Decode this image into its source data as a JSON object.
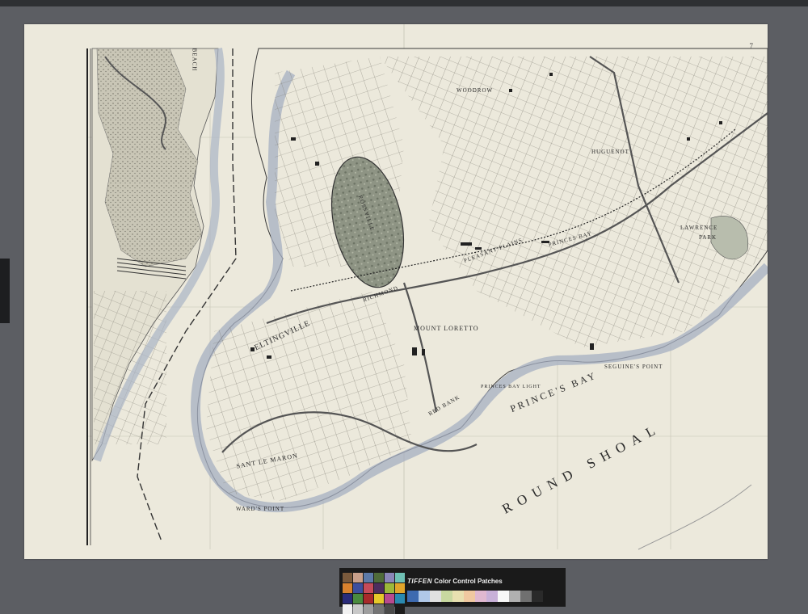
{
  "map": {
    "sheet_number": "7",
    "labels": {
      "beach": "BEACH",
      "woodrow": "WOODROW",
      "huguenot": "HUGUENOT",
      "rossville_park": "ROSSVILLE",
      "eltingville": "ELTINGVILLE",
      "richmond": "RICHMOND",
      "princes_bay_village": "PRINCES BAY",
      "lawrence_park": "LAWRENCE",
      "park": "PARK",
      "mount_loretto": "MOUNT LORETTO",
      "pleasant_plains": "PLEASANT PLAINS",
      "princes_bay_water": "PRINCE'S BAY",
      "round_shoal": "ROUND SHOAL",
      "seguines_point": "SEGUINE'S POINT",
      "wards_point": "WARD'S POINT",
      "red_bank": "RED BANK",
      "princes_bay_light": "PRINCES BAY LIGHT",
      "tottenville": "SANT LE MARON"
    }
  },
  "color_target": {
    "brand": "TIFFEN",
    "title": "Color Control Patches",
    "swatch_colors": [
      "#7a5a3c",
      "#c9a08a",
      "#5d7aa8",
      "#4f6b3a",
      "#8a86b8",
      "#6fc0b4",
      "#d8822e",
      "#3d4f9e",
      "#c44b5a",
      "#4d2d5e",
      "#9cb83a",
      "#e0a52a",
      "#2a2c7a",
      "#4a8a3e",
      "#a82a2a",
      "#e6c92a",
      "#b84a8e",
      "#2a8ab0",
      "#f2f2f2",
      "#c8c8c8",
      "#9e9e9e",
      "#747474",
      "#4a4a4a",
      "#1c1c1c"
    ],
    "scale_colors": [
      "#3d6ab0",
      "#b0c8e8",
      "#e0e0e0",
      "#c8d8a0",
      "#e8e0b0",
      "#f0c8a0",
      "#e0b8d0",
      "#c8b0d8",
      "#f8f8f8",
      "#b0b0b0",
      "#707070",
      "#2a2a2a"
    ]
  }
}
